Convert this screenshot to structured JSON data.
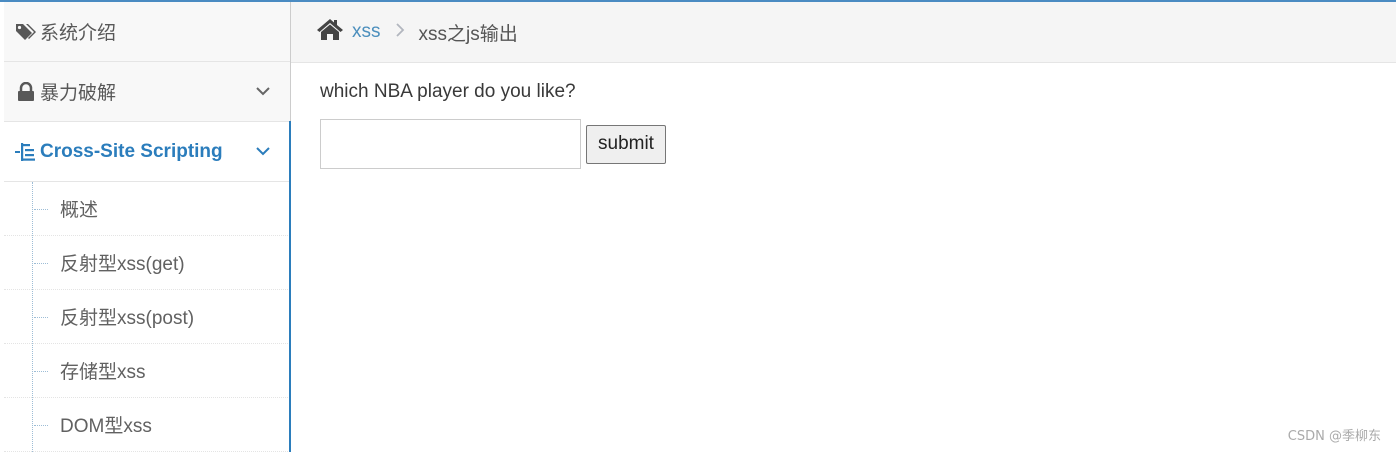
{
  "sidebar": {
    "items": [
      {
        "label": "系统介绍",
        "icon": "tags-icon"
      },
      {
        "label": "暴力破解",
        "icon": "lock-icon"
      },
      {
        "label": "Cross-Site Scripting",
        "icon": "sitemap-icon",
        "active": true
      }
    ],
    "submenu": [
      {
        "label": "概述"
      },
      {
        "label": "反射型xss(get)"
      },
      {
        "label": "反射型xss(post)"
      },
      {
        "label": "存储型xss"
      },
      {
        "label": "DOM型xss"
      }
    ]
  },
  "breadcrumb": {
    "home_icon": "home-icon",
    "link": "xss",
    "current": "xss之js输出"
  },
  "content": {
    "question": "which NBA player do you like?",
    "input_value": "",
    "submit_label": "submit"
  },
  "watermark": "CSDN @季柳东",
  "colors": {
    "accent": "#2b7dbc",
    "link": "#4c8fbd",
    "sidebar_bg": "#f8f8f8",
    "breadcrumb_bg": "#f5f5f5"
  }
}
